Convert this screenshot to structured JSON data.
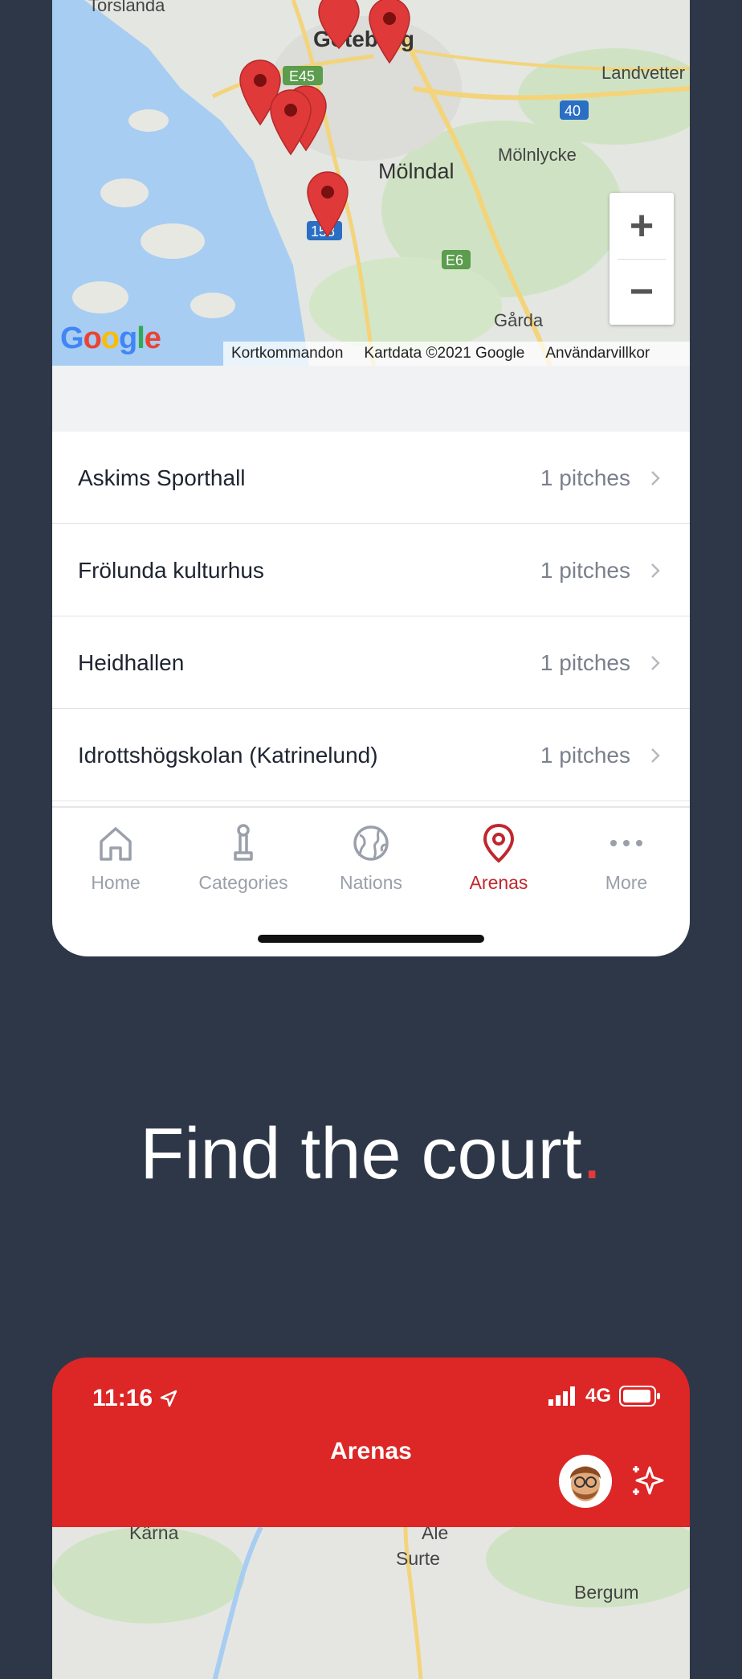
{
  "map": {
    "places": [
      "Torslanda",
      "Göteborg",
      "Landvetter",
      "Mölnlycke",
      "Mölndal",
      "Gårda"
    ],
    "road_badges": [
      "E45",
      "40",
      "E6",
      "158"
    ],
    "zoom_in": "+",
    "zoom_out": "−",
    "google_logo": "Google",
    "footer": [
      "Kortkommandon",
      "Kartdata ©2021 Google",
      "Användarvillkor"
    ]
  },
  "arenas": [
    {
      "name": "Askims Sporthall",
      "count": "1 pitches"
    },
    {
      "name": "Frölunda kulturhus",
      "count": "1 pitches"
    },
    {
      "name": "Heidhallen",
      "count": "1 pitches"
    },
    {
      "name": "Idrottshögskolan (Katrinelund)",
      "count": "1 pitches"
    }
  ],
  "tabs": [
    {
      "label": "Home",
      "icon": "home-icon",
      "active": false
    },
    {
      "label": "Categories",
      "icon": "trophy-icon",
      "active": false
    },
    {
      "label": "Nations",
      "icon": "globe-icon",
      "active": false
    },
    {
      "label": "Arenas",
      "icon": "location-pin-icon",
      "active": true
    },
    {
      "label": "More",
      "icon": "more-icon",
      "active": false
    }
  ],
  "headline": {
    "text": "Find the court",
    "dot": "."
  },
  "second_screen": {
    "time": "11:16",
    "network": "4G",
    "title": "Arenas",
    "map_places": [
      "Ale",
      "Surte",
      "Bergum"
    ]
  },
  "colors": {
    "brand_red": "#dd2626",
    "active_tab": "#c0272d",
    "background": "#2e3747"
  }
}
